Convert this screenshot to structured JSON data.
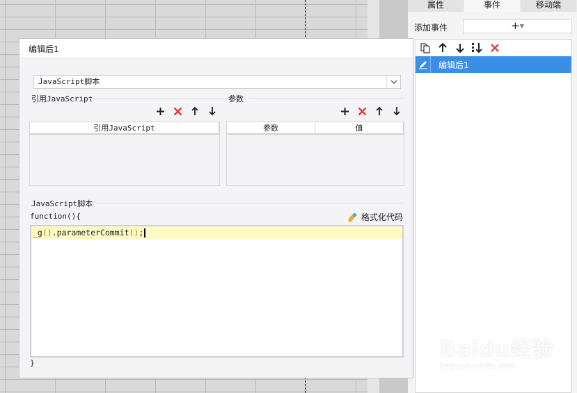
{
  "panel": {
    "tabs": [
      "属性",
      "事件",
      "移动端"
    ],
    "active_tab": 1,
    "add_event_label": "添加事件",
    "add_event_button": "+",
    "event_items": [
      {
        "label": "编辑后1",
        "selected": true
      }
    ],
    "toolbar_icons": [
      "copy-icon",
      "move-up-icon",
      "move-down-icon",
      "sort-icon",
      "delete-icon"
    ]
  },
  "dialog": {
    "title": "编辑后1",
    "script_type": "JavaScript脚本",
    "ref_js": {
      "label": "引用JavaScript",
      "columns": [
        "引用JavaScript"
      ],
      "rows": []
    },
    "params": {
      "label": "参数",
      "columns": [
        "参数",
        "值"
      ],
      "rows": []
    },
    "script": {
      "label": "JavaScript脚本",
      "header": "function(){",
      "code_pre": "_g",
      "code_paren1": "()",
      "code_mid": ".parameterCommit",
      "code_paren2": "()",
      "code_post": ";",
      "footer": "}",
      "format_label": "格式化代码"
    }
  },
  "watermark": {
    "brand": "Baidu经验",
    "url": "jingyan.baidu.com"
  },
  "colors": {
    "accent": "#3a8ee6",
    "delete": "#e53935",
    "code_highlight": "#fdfac4"
  }
}
